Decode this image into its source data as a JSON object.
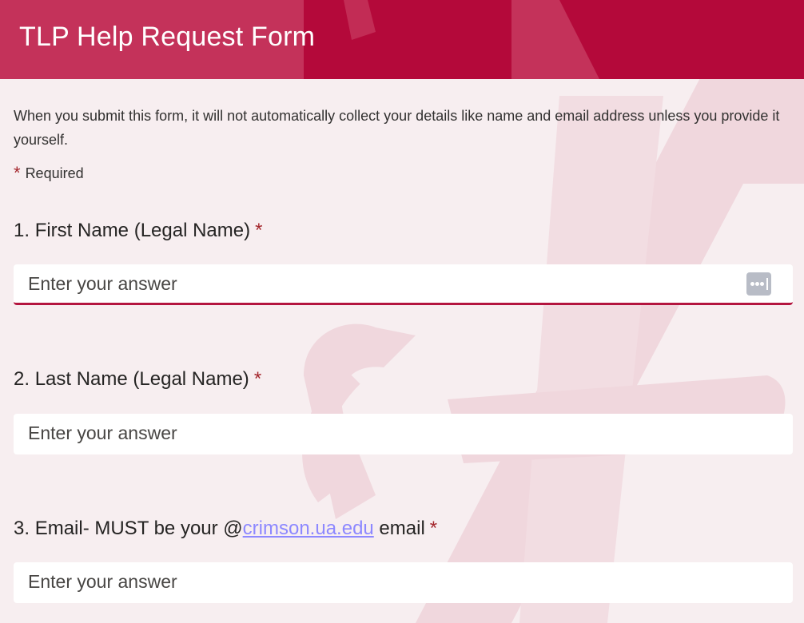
{
  "form": {
    "title": "TLP Help Request Form",
    "notice": "When you submit this form, it will not automatically collect your details like name and email address unless you provide it yourself.",
    "required_marker": "*",
    "required_label": "Required"
  },
  "questions": [
    {
      "number": "1.",
      "label": "First Name (Legal Name)",
      "placeholder": "Enter your answer",
      "value": "",
      "required": true,
      "focused": true,
      "field_icon": "password-manager-icon"
    },
    {
      "number": "2.",
      "label": "Last Name (Legal Name)",
      "placeholder": "Enter your answer",
      "value": "",
      "required": true
    },
    {
      "number": "3.",
      "label_prefix": "Email- MUST be your @",
      "label_link": "crimson.ua.edu",
      "label_suffix": " email",
      "placeholder": "Enter your answer",
      "value": "",
      "required": true
    }
  ],
  "colors": {
    "header_bg": "#c4325a",
    "header_shape": "#b4093a",
    "page_bg": "#f7eef0",
    "required_star": "#a4262c",
    "focus_underline": "#b4153f",
    "link": "#8d88ff"
  }
}
